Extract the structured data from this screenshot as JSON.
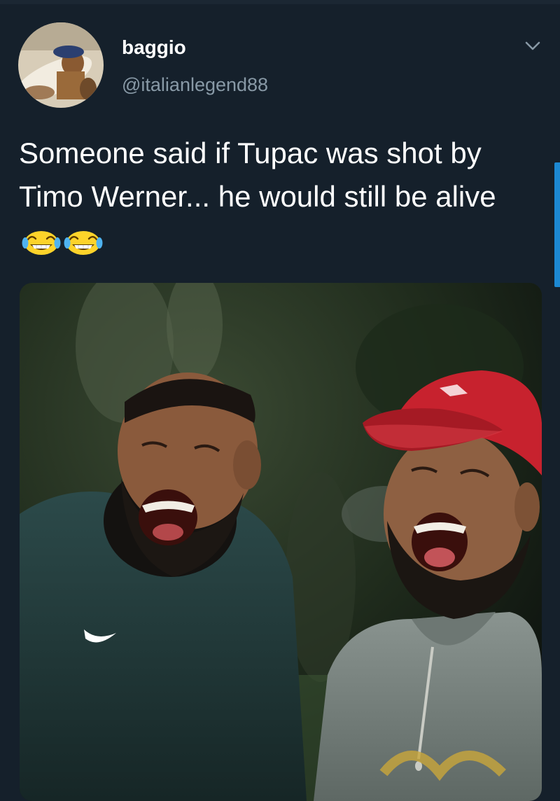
{
  "tweet": {
    "author": {
      "display_name": "baggio",
      "handle": "@italianlegend88"
    },
    "text": "Someone said if Tupac was shot by Timo Werner... he would still be alive",
    "emojis": [
      "tears-of-joy-emoji",
      "tears-of-joy-emoji"
    ],
    "menu_icon": "chevron-down-icon",
    "media": {
      "alt": "photo of two bearded men laughing"
    }
  },
  "colors": {
    "background": "#15202b",
    "secondary_text": "#8899a6",
    "accent": "#1d9bf0",
    "cap_red": "#c7222e",
    "nike_logo": "#ffffff"
  }
}
